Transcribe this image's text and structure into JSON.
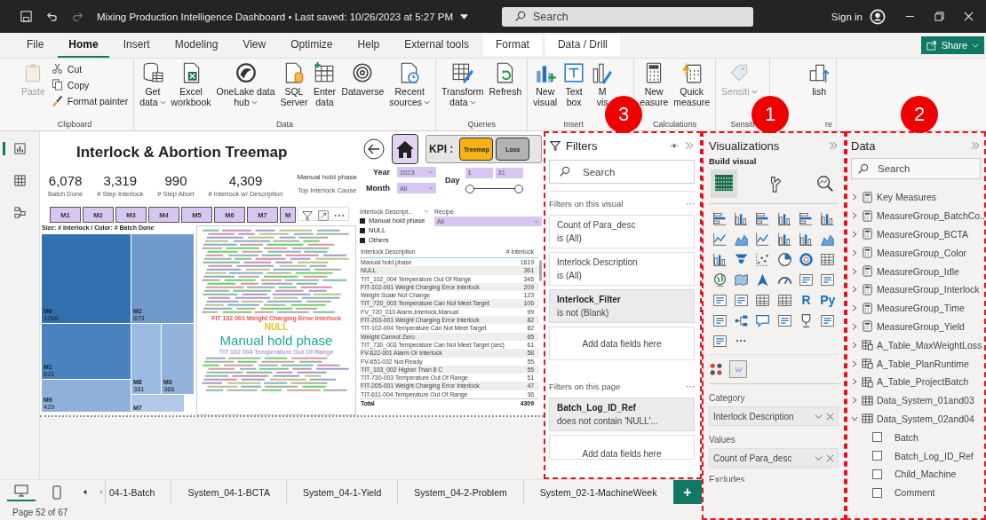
{
  "window": {
    "title": "Mixing Production Intelligence Dashboard • Last saved: 10/26/2023 at 5:27 PM",
    "search": {
      "placeholder": "Search"
    },
    "sign_in": "Sign in"
  },
  "menu_tabs": [
    {
      "label": "File",
      "selected": false,
      "kind": "standard"
    },
    {
      "label": "Home",
      "selected": true,
      "kind": "standard"
    },
    {
      "label": "Insert",
      "selected": false,
      "kind": "standard"
    },
    {
      "label": "Modeling",
      "selected": false,
      "kind": "standard"
    },
    {
      "label": "View",
      "selected": false,
      "kind": "standard"
    },
    {
      "label": "Optimize",
      "selected": false,
      "kind": "standard"
    },
    {
      "label": "Help",
      "selected": false,
      "kind": "standard"
    },
    {
      "label": "External tools",
      "selected": false,
      "kind": "standard"
    },
    {
      "label": "Format",
      "selected": false,
      "kind": "contextual"
    },
    {
      "label": "Data / Drill",
      "selected": false,
      "kind": "contextual"
    }
  ],
  "share_button": "Share",
  "ribbon_groups": [
    {
      "label": "Clipboard",
      "buttons": [
        {
          "lines": [
            "Paste"
          ],
          "kind": "large",
          "disabled": true,
          "dropdown": false
        },
        {
          "lines": [
            "Cut"
          ],
          "kind": "small",
          "disabled": false,
          "dropdown": false
        },
        {
          "lines": [
            "Copy"
          ],
          "kind": "small",
          "disabled": false,
          "dropdown": false
        },
        {
          "lines": [
            "Format painter"
          ],
          "kind": "small",
          "disabled": false,
          "dropdown": false
        }
      ]
    },
    {
      "label": "Data",
      "buttons": [
        {
          "lines": [
            "Get",
            "data"
          ],
          "kind": "large",
          "disabled": false,
          "dropdown": true
        },
        {
          "lines": [
            "Excel",
            "workbook"
          ],
          "kind": "large",
          "disabled": false,
          "dropdown": false
        },
        {
          "lines": [
            "OneLake data",
            "hub"
          ],
          "kind": "large",
          "disabled": false,
          "dropdown": true
        },
        {
          "lines": [
            "SQL",
            "Server"
          ],
          "kind": "large",
          "disabled": false,
          "dropdown": false
        },
        {
          "lines": [
            "Enter",
            "data"
          ],
          "kind": "large",
          "disabled": false,
          "dropdown": false
        },
        {
          "lines": [
            "Dataverse"
          ],
          "kind": "large",
          "disabled": false,
          "dropdown": false
        },
        {
          "lines": [
            "Recent",
            "sources"
          ],
          "kind": "large",
          "disabled": false,
          "dropdown": true
        }
      ]
    },
    {
      "label": "Queries",
      "buttons": [
        {
          "lines": [
            "Transform",
            "data"
          ],
          "kind": "large",
          "disabled": false,
          "dropdown": true
        },
        {
          "lines": [
            "Refresh"
          ],
          "kind": "large",
          "disabled": false,
          "dropdown": false
        }
      ]
    },
    {
      "label": "Insert",
      "buttons": [
        {
          "lines": [
            "New",
            "visual"
          ],
          "kind": "large",
          "disabled": false,
          "dropdown": false
        },
        {
          "lines": [
            "Text",
            "box"
          ],
          "kind": "large",
          "disabled": false,
          "dropdown": false
        },
        {
          "lines": [
            "M",
            "vis"
          ],
          "kind": "large",
          "disabled": false,
          "dropdown": false
        }
      ]
    },
    {
      "label": "Calculations",
      "buttons": [
        {
          "lines": [
            "New",
            "easure"
          ],
          "kind": "large",
          "disabled": false,
          "dropdown": false
        },
        {
          "lines": [
            "Quick",
            "measure"
          ],
          "kind": "large",
          "disabled": false,
          "dropdown": false
        }
      ]
    },
    {
      "label": "Sensiti",
      "buttons": [
        {
          "lines": [
            "Sensiti"
          ],
          "kind": "large",
          "disabled": true,
          "dropdown": true
        }
      ]
    },
    {
      "label": "re",
      "buttons": [
        {
          "lines": [
            "lish"
          ],
          "kind": "large",
          "disabled": false,
          "dropdown": false
        }
      ]
    }
  ],
  "left_nav": [
    {
      "selected": true
    },
    {
      "selected": false
    },
    {
      "selected": false
    }
  ],
  "report": {
    "title": "Interlock & Abortion Treemap",
    "kpis": [
      {
        "value": "6,078",
        "label": "Batch Done"
      },
      {
        "value": "3,319",
        "label": "# Step Interlock"
      },
      {
        "value": "990",
        "label": "# Step Abort"
      },
      {
        "value": "4,309",
        "label": "# Interlock w/ Description"
      }
    ],
    "top_cause": {
      "value": "Manual hold phase",
      "label": "Top Interlock Cause"
    },
    "kpi_switch": {
      "label": "KPI :",
      "options": [
        {
          "label": "Treemap",
          "selected": true
        },
        {
          "label": "Loss",
          "selected": false
        }
      ]
    },
    "year": {
      "label": "Year",
      "value": "2023"
    },
    "month": {
      "label": "Month",
      "value": "All"
    },
    "day": {
      "label": "Day",
      "from": "1",
      "to": "31",
      "thumbs": [
        {
          "level": 0
        },
        {
          "level": 1
        }
      ]
    },
    "machines": [
      "M1",
      "M2",
      "M3",
      "M4",
      "M5",
      "M6",
      "M7",
      "M"
    ],
    "treemap": {
      "title": "Size: # Interlock / Color: # Batch Done",
      "tiles": [
        {
          "label": "M6",
          "value": "1268",
          "color": "#3270b0"
        },
        {
          "label": "M2",
          "value": "873",
          "color": "#6f9acb"
        },
        {
          "label": "M1",
          "value": "831",
          "color": "#4a82bf"
        },
        {
          "label": "M9",
          "value": "429",
          "color": "#8fb0da"
        },
        {
          "label": "M8",
          "value": "381",
          "color": "#9cbbe0"
        },
        {
          "label": "M3",
          "value": "366",
          "color": "#93b3dc"
        },
        {
          "label": "M7",
          "color": "#b2c8e8"
        }
      ]
    },
    "word_cloud": [
      {
        "text": "FIT 102 001 Weight Charging Error Interlock",
        "kind": "medium",
        "color": "#f0504a"
      },
      {
        "text": "NULL",
        "kind": "accent",
        "color": "#e8c020"
      },
      {
        "text": "Manual hold phase",
        "kind": "main",
        "color": "#20a89a"
      },
      {
        "text": "TIT 102 004 Temperature Out Of Range",
        "kind": "medium",
        "color": "#b49ae0"
      }
    ],
    "legend": {
      "title": "Interlock Descript...",
      "items": [
        "Manual hold phase",
        "NULL",
        "Others"
      ]
    },
    "recipe": {
      "label": "Recipe",
      "value": "All"
    },
    "table": {
      "columns": [
        "Interlock Description",
        "# Interlock"
      ],
      "rows": [
        [
          "Manual hold phase",
          "1619"
        ],
        [
          "NULL",
          "361"
        ],
        [
          "TIT_102_004 Temperature Out Of Range",
          "345"
        ],
        [
          "FIT-102-001 Weight Charging Error Interlock",
          "209"
        ],
        [
          "Weight Scale Not Change",
          "123"
        ],
        [
          "TIT_720_003 Temperature Can Not Meet Target",
          "106"
        ],
        [
          "FV_720_010 Alarm,Interlock,Manual",
          "99"
        ],
        [
          "FIT-203-001 Weight Charging Error Interlock",
          "82"
        ],
        [
          "TIT-102-004 Temperature Can Not Meet Target",
          "82"
        ],
        [
          "Weight Cannot Zero",
          "65"
        ],
        [
          "TIT_730_003 Temperature Can Not Meet Target (sec)",
          "61"
        ],
        [
          "FV-622-001 Alarm Or Interlock",
          "58"
        ],
        [
          "FV-651-032 Not Ready",
          "55"
        ],
        [
          "TIT_103_002 Higher Than 8 C",
          "55"
        ],
        [
          "TIT-730-003 Temperature Out Of Range",
          "51"
        ],
        [
          "FIT-205-001 Weight Charging Error Interlock",
          "47"
        ],
        [
          "TIT-611-004 Temperature Out Of Range",
          "36"
        ]
      ],
      "total": [
        "Total",
        "4309"
      ]
    }
  },
  "filters": {
    "title": "Filters",
    "callout": "3",
    "search": {
      "placeholder": "Search"
    },
    "visual_section": "Filters on this visual",
    "more": "···",
    "visual_cards": [
      {
        "field": "Count of Para_desc",
        "condition": "is (All)",
        "applied": false
      },
      {
        "field": "Interlock Description",
        "condition": "is (All)",
        "applied": false
      },
      {
        "field": "Interlock_Filter",
        "condition": "is not (Blank)",
        "applied": true
      }
    ],
    "add_fields": "Add data fields here",
    "page_section": "Filters on this page",
    "page_cards": [
      {
        "field": "Batch_Log_ID_Ref",
        "condition": "does not contain 'NULL'...",
        "applied": true
      }
    ],
    "page_add_fields": "Add data fields here"
  },
  "visualizations": {
    "title": "Visualizations",
    "callout": "1",
    "build_label": "Build visual",
    "text_glyphs": [
      "R",
      "Py"
    ],
    "more": "···",
    "wells": [
      {
        "label": "Category",
        "field": "Interlock Description"
      },
      {
        "label": "Values",
        "field": "Count of Para_desc"
      }
    ],
    "cut_label": "Excludes"
  },
  "data_pane": {
    "title": "Data",
    "callout": "2",
    "search": {
      "placeholder": "Search"
    },
    "items": [
      {
        "name": "Key Measures",
        "kind": "measure",
        "expanded": false
      },
      {
        "name": "MeasureGroup_BatchCo...",
        "kind": "measure",
        "expanded": false
      },
      {
        "name": "MeasureGroup_BCTA",
        "kind": "measure",
        "expanded": false
      },
      {
        "name": "MeasureGroup_Color",
        "kind": "measure",
        "expanded": false
      },
      {
        "name": "MeasureGroup_Idle",
        "kind": "measure",
        "expanded": false
      },
      {
        "name": "MeasureGroup_Interlock",
        "kind": "measure",
        "expanded": false
      },
      {
        "name": "MeasureGroup_Time",
        "kind": "measure",
        "expanded": false
      },
      {
        "name": "MeasureGroup_Yield",
        "kind": "measure",
        "expanded": false
      },
      {
        "name": "A_Table_MaxWeightLoss",
        "kind": "calc_table",
        "expanded": false
      },
      {
        "name": "A_Table_PlanRuntime",
        "kind": "calc_table",
        "expanded": false
      },
      {
        "name": "A_Table_ProjectBatch",
        "kind": "calc_table",
        "expanded": false
      },
      {
        "name": "Data_System_01and03",
        "kind": "table",
        "expanded": false
      },
      {
        "name": "Data_System_02and04",
        "kind": "table",
        "expanded": true,
        "children": [
          {
            "name": "Batch",
            "checked": false
          },
          {
            "name": "Batch_Log_ID_Ref",
            "checked": false
          },
          {
            "name": "Child_Machine",
            "checked": false
          },
          {
            "name": "Comment",
            "checked": false
          }
        ]
      }
    ]
  },
  "page_tabs": [
    {
      "label": "04-1-Batch",
      "selected": false
    },
    {
      "label": "System_04-1-BCTA",
      "selected": false
    },
    {
      "label": "System_04-1-Yield",
      "selected": false
    },
    {
      "label": "System_04-2-Problem",
      "selected": false
    },
    {
      "label": "System_02-1-MachineWeek",
      "selected": false
    }
  ],
  "add_page_button": "+",
  "status": "Page 52 of 67"
}
